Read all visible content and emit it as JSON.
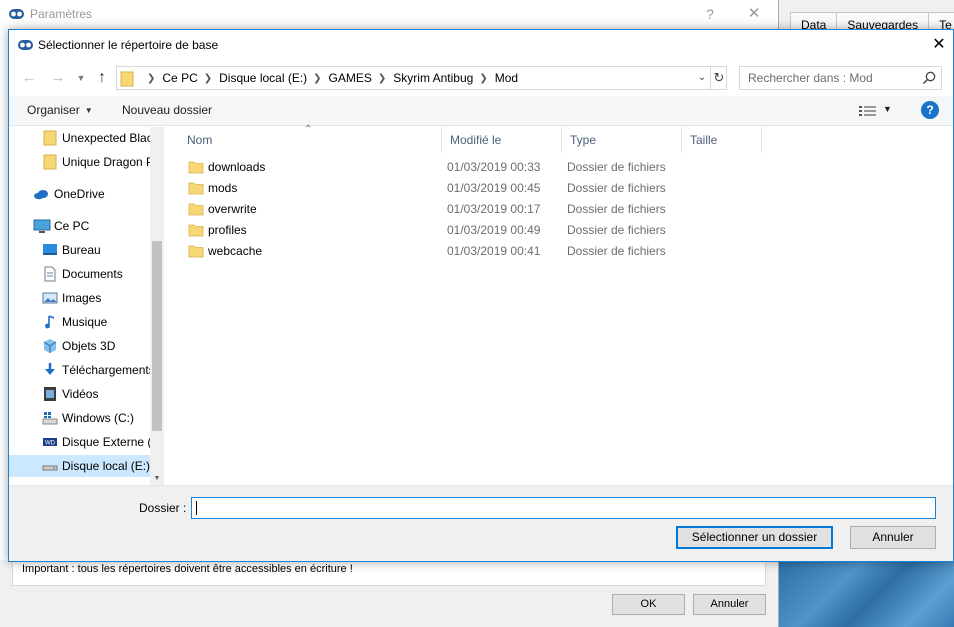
{
  "background_app": {
    "tabs": [
      "Data",
      "Sauvegardes",
      "Te"
    ]
  },
  "param_window": {
    "title": "Paramètres",
    "help_glyph": "?",
    "close_glyph": "✕",
    "note": "Important : tous les répertoires doivent être accessibles en écriture !",
    "ok_label": "OK",
    "cancel_label": "Annuler"
  },
  "dialog": {
    "title": "Sélectionner le répertoire de base",
    "close_glyph": "✕",
    "address": {
      "crumbs": [
        "Ce PC",
        "Disque local (E:)",
        "GAMES",
        "Skyrim Antibug",
        "Mod"
      ]
    },
    "search": {
      "placeholder": "Rechercher dans : Mod"
    },
    "toolbar": {
      "organize_label": "Organiser",
      "new_folder_label": "Nouveau dossier",
      "help_label": "?"
    },
    "nav_pane": {
      "items": [
        {
          "label": "Unexpected Black",
          "icon": "folder-icon",
          "indent": 1,
          "selected": false
        },
        {
          "label": "Unique Dragon Priest",
          "icon": "folder-icon",
          "indent": 1,
          "selected": false
        },
        {
          "label": "OneDrive",
          "icon": "onedrive-icon",
          "indent": 0,
          "selected": false
        },
        {
          "label": "Ce PC",
          "icon": "computer-icon",
          "indent": 0,
          "selected": false
        },
        {
          "label": "Bureau",
          "icon": "desktop-icon",
          "indent": 1,
          "selected": false
        },
        {
          "label": "Documents",
          "icon": "documents-icon",
          "indent": 1,
          "selected": false
        },
        {
          "label": "Images",
          "icon": "pictures-icon",
          "indent": 1,
          "selected": false
        },
        {
          "label": "Musique",
          "icon": "music-icon",
          "indent": 1,
          "selected": false
        },
        {
          "label": "Objets 3D",
          "icon": "3d-objects-icon",
          "indent": 1,
          "selected": false
        },
        {
          "label": "Téléchargements",
          "icon": "downloads-icon",
          "indent": 1,
          "selected": false
        },
        {
          "label": "Vidéos",
          "icon": "videos-icon",
          "indent": 1,
          "selected": false
        },
        {
          "label": "Windows (C:)",
          "icon": "windows-drive-icon",
          "indent": 1,
          "selected": false
        },
        {
          "label": "Disque Externe (F:)",
          "icon": "external-drive-icon",
          "indent": 1,
          "selected": false
        },
        {
          "label": "Disque local (E:)",
          "icon": "drive-icon",
          "indent": 1,
          "selected": true
        }
      ]
    },
    "columns": {
      "name": "Nom",
      "modified": "Modifié le",
      "type": "Type",
      "size": "Taille"
    },
    "files": [
      {
        "name": "downloads",
        "modified": "01/03/2019 00:33",
        "type": "Dossier de fichiers"
      },
      {
        "name": "mods",
        "modified": "01/03/2019 00:45",
        "type": "Dossier de fichiers"
      },
      {
        "name": "overwrite",
        "modified": "01/03/2019 00:17",
        "type": "Dossier de fichiers"
      },
      {
        "name": "profiles",
        "modified": "01/03/2019 00:49",
        "type": "Dossier de fichiers"
      },
      {
        "name": "webcache",
        "modified": "01/03/2019 00:41",
        "type": "Dossier de fichiers"
      }
    ],
    "folder_field": {
      "label": "Dossier :",
      "value": ""
    },
    "select_button_label": "Sélectionner un dossier",
    "cancel_button_label": "Annuler"
  },
  "colors": {
    "accent": "#0078d7",
    "folder": "#f8d775",
    "selection": "#cce8ff",
    "header_text": "#4c607a"
  }
}
